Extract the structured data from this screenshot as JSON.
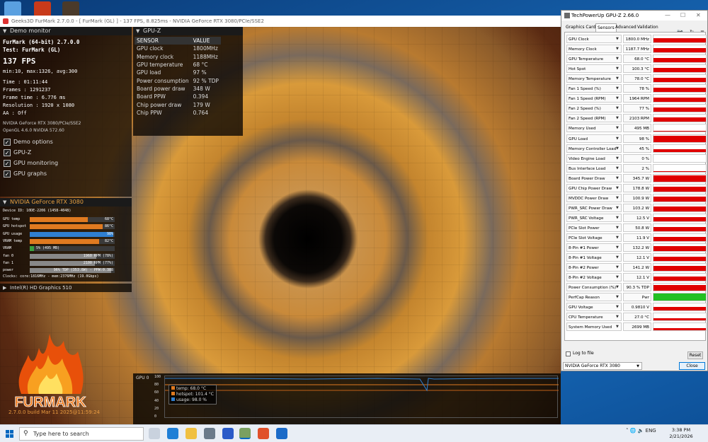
{
  "furmark": {
    "window_title": "Geeks3D FurMark 2.7.0.0 - [ FurMark (GL) ] - 137 FPS, 8.825ms - NVIDIA GeForce RTX 3080/PCIe/SSE2",
    "demo_header": "Demo monitor",
    "app_name": "FurMark (64-bit) 2.7.0.0",
    "test": "Test: FurMark (GL)",
    "fps": "137 FPS",
    "fps_range": "min:10, max:1326, avg:300",
    "time": "Time       : 01:11:44",
    "frames": "Frames     : 1291237",
    "frame_time": "Frame time : 6.776 ms",
    "resolution": "Resolution : 1920 x 1080",
    "aa": "AA         : Off",
    "renderer": "NVIDIA GeForce RTX 3080/PCIe/SSE2",
    "opengl": "OpenGL 4.6.0 NVIDIA 572.60",
    "options": [
      "Demo options",
      "GPU-Z",
      "GPU monitoring",
      "GPU graphs"
    ],
    "gpu_header": "NVIDIA GeForce RTX 3080",
    "device_id": "Device ID:   10DE-2206 (1458-4048)",
    "bars": [
      {
        "label": "GPU temp",
        "value": 0.68,
        "text": "68°C",
        "color": "#e07a20"
      },
      {
        "label": "GPU hotspot",
        "value": 0.86,
        "text": "86°C",
        "color": "#e07a20"
      },
      {
        "label": "GPU usage",
        "value": 0.98,
        "text": "98%",
        "color": "#2f7fd0"
      },
      {
        "label": "VRAM temp",
        "value": 0.82,
        "text": "82°C",
        "color": "#e07a20"
      },
      {
        "label": "VRAM",
        "value": 0.05,
        "text": "5% (495 MB)",
        "color": "#3aa040"
      },
      {
        "label": "fan 0",
        "value": 0.78,
        "text": "1960 RPM (78%)",
        "color": "#888888"
      },
      {
        "label": "fan 1",
        "value": 0.77,
        "text": "2100 RPM (77%)",
        "color": "#888888"
      },
      {
        "label": "power",
        "value": 0.96,
        "text": "96% TDP (353.8W) - PPW:0.388",
        "color": "#888888"
      }
    ],
    "clocks": "Clocks:    core:1816MHz - mem:2376MHz (19.0Gbps)",
    "intel_header": "Intel(R) HD Graphics 510",
    "build": "2.7.0.0 build Mar 11 2025@11:59:24",
    "logo_text": "FURMARK"
  },
  "gpuz_overlay": {
    "header": "GPU-Z",
    "columns": [
      "SENSOR",
      "VALUE"
    ],
    "rows": [
      [
        "GPU clock",
        "1800MHz"
      ],
      [
        "Memory clock",
        "1188MHz"
      ],
      [
        "GPU temperature",
        "68 °C"
      ],
      [
        "GPU load",
        "97 %"
      ],
      [
        "Power consumption",
        "92 % TDP"
      ],
      [
        "Board power draw",
        "348 W"
      ],
      [
        "Board PPW",
        "0.394"
      ],
      [
        "Chip power draw",
        "179 W"
      ],
      [
        "Chip PPW",
        "0.764"
      ]
    ]
  },
  "graph": {
    "label": "GPU 0",
    "yticks": [
      "100",
      "80",
      "60",
      "40",
      "20",
      "0"
    ],
    "legend": [
      {
        "label": "temp: 68.0 °C",
        "color": "#e07a20"
      },
      {
        "label": "hotspot: 101.4 °C",
        "color": "#e07a20"
      },
      {
        "label": "usage: 98.0 %",
        "color": "#2f7fd0"
      }
    ]
  },
  "gpuz": {
    "title": "TechPowerUp GPU-Z 2.66.0",
    "tabs": [
      "Graphics Card",
      "Sensors",
      "Advanced",
      "Validation"
    ],
    "active_tab": "Sensors",
    "sensors": [
      {
        "name": "GPU Clock",
        "value": "1800.0 MHz",
        "level": 0.6,
        "color": "#e00000"
      },
      {
        "name": "Memory Clock",
        "value": "1187.7 MHz",
        "level": 0.6,
        "color": "#e00000"
      },
      {
        "name": "GPU Temperature",
        "value": "68.0 °C",
        "level": 0.6,
        "color": "#e00000"
      },
      {
        "name": "Hot Spot",
        "value": "100.3 °C",
        "level": 0.6,
        "color": "#e00000"
      },
      {
        "name": "Memory Temperature",
        "value": "78.0 °C",
        "level": 0.6,
        "color": "#e00000"
      },
      {
        "name": "Fan 1 Speed (%)",
        "value": "78 %",
        "level": 0.6,
        "color": "#e00000"
      },
      {
        "name": "Fan 1 Speed (RPM)",
        "value": "1964 RPM",
        "level": 0.6,
        "color": "#e00000"
      },
      {
        "name": "Fan 2 Speed (%)",
        "value": "77 %",
        "level": 0.6,
        "color": "#e00000"
      },
      {
        "name": "Fan 2 Speed (RPM)",
        "value": "2103 RPM",
        "level": 0.6,
        "color": "#e00000"
      },
      {
        "name": "Memory Used",
        "value": "495 MB",
        "level": 0.1,
        "color": "#e00000"
      },
      {
        "name": "GPU Load",
        "value": "98 %",
        "level": 0.9,
        "color": "#e00000"
      },
      {
        "name": "Memory Controller Load",
        "value": "45 %",
        "level": 0.4,
        "color": "#e00000"
      },
      {
        "name": "Video Engine Load",
        "value": "0 %",
        "level": 0,
        "color": "#e00000"
      },
      {
        "name": "Bus Interface Load",
        "value": "2 %",
        "level": 0.05,
        "color": "#e00000"
      },
      {
        "name": "Board Power Draw",
        "value": "345.7 W",
        "level": 0.85,
        "color": "#e00000"
      },
      {
        "name": "GPU Chip Power Draw",
        "value": "178.8 W",
        "level": 0.7,
        "color": "#e00000"
      },
      {
        "name": "MVDDC Power Draw",
        "value": "100.9 W",
        "level": 0.7,
        "color": "#e00000"
      },
      {
        "name": "PWR_SRC Power Draw",
        "value": "103.2 W",
        "level": 0.7,
        "color": "#e00000"
      },
      {
        "name": "PWR_SRC Voltage",
        "value": "12.5 V",
        "level": 0.6,
        "color": "#e00000"
      },
      {
        "name": "PCIe Slot Power",
        "value": "50.8 W",
        "level": 0.6,
        "color": "#e00000"
      },
      {
        "name": "PCIe Slot Voltage",
        "value": "11.9 V",
        "level": 0.6,
        "color": "#e00000"
      },
      {
        "name": "8-Pin #1 Power",
        "value": "132.2 W",
        "level": 0.7,
        "color": "#e00000"
      },
      {
        "name": "8-Pin #1 Voltage",
        "value": "12.1 V",
        "level": 0.6,
        "color": "#e00000"
      },
      {
        "name": "8-Pin #2 Power",
        "value": "141.2 W",
        "level": 0.7,
        "color": "#e00000"
      },
      {
        "name": "8-Pin #2 Voltage",
        "value": "12.1 V",
        "level": 0.6,
        "color": "#e00000"
      },
      {
        "name": "Power Consumption (%)",
        "value": "90.3 % TDP",
        "level": 0.8,
        "color": "#e00000"
      },
      {
        "name": "PerfCap Reason",
        "value": "Pwr",
        "level": 1,
        "color": "#22c022"
      },
      {
        "name": "GPU Voltage",
        "value": "0.9810 V",
        "level": 0.5,
        "color": "#e00000"
      },
      {
        "name": "CPU Temperature",
        "value": "27.0 °C",
        "level": 0.3,
        "color": "#e00000"
      },
      {
        "name": "System Memory Used",
        "value": "2699 MB",
        "level": 0.3,
        "color": "#e00000"
      }
    ],
    "log_label": "Log to file",
    "reset_label": "Reset",
    "gpu_select": "NVIDIA GeForce RTX 3080",
    "close_label": "Close"
  },
  "taskbar": {
    "search_placeholder": "Type here to search",
    "lang": "ENG",
    "time": "3:38 PM",
    "date": "2/21/2026"
  }
}
